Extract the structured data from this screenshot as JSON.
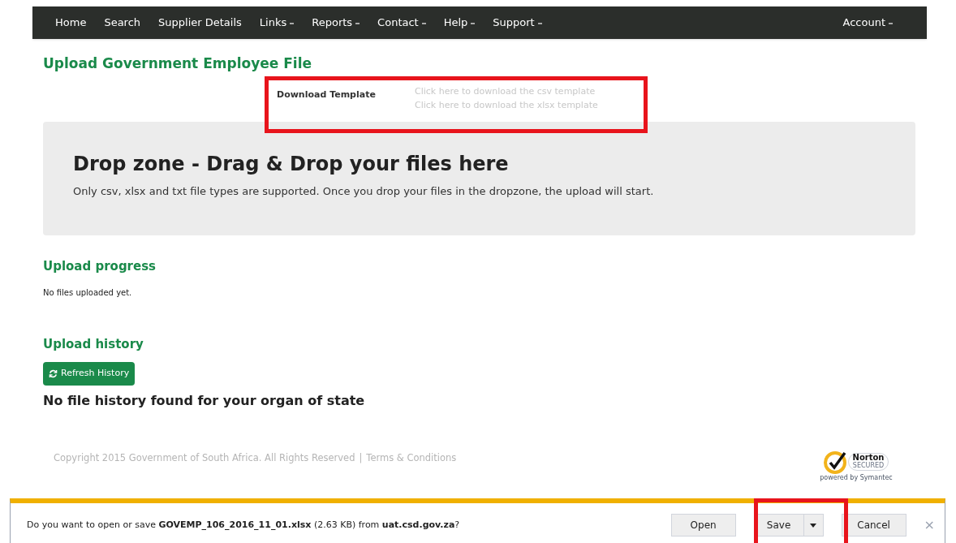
{
  "nav": {
    "items": [
      {
        "label": "Home",
        "dropdown": false
      },
      {
        "label": "Search",
        "dropdown": false
      },
      {
        "label": "Supplier Details",
        "dropdown": false
      },
      {
        "label": "Links",
        "dropdown": true
      },
      {
        "label": "Reports",
        "dropdown": true
      },
      {
        "label": "Contact",
        "dropdown": true
      },
      {
        "label": "Help",
        "dropdown": true
      },
      {
        "label": "Support",
        "dropdown": true
      }
    ],
    "account": {
      "label": "Account",
      "dropdown": true
    }
  },
  "page_title": "Upload Government Employee File",
  "download_template": {
    "label": "Download Template",
    "links": [
      "Click here to download the csv template",
      "Click here to download the xlsx template"
    ]
  },
  "drop_zone": {
    "heading": "Drop zone - Drag & Drop your files here",
    "hint": "Only csv, xlsx and txt file types are supported. Once you drop your files in the dropzone, the upload will start."
  },
  "upload_progress": {
    "heading": "Upload progress",
    "message": "No files uploaded yet."
  },
  "upload_history": {
    "heading": "Upload history",
    "button": "Refresh History",
    "message": "No file history found for your organ of state"
  },
  "footer": {
    "copyright": "Copyright 2015 Government of South Africa. All Rights Reserved",
    "separator": "|",
    "terms": "Terms & Conditions",
    "seal": {
      "name": "Norton",
      "sub": "SECURED",
      "by": "powered by Symantec"
    }
  },
  "download_bar": {
    "message": "Do you want to open or save **GOVEMP_106_2016_11_01.xlsx** (2.63 KB) from **uat.csd.gov.za**?",
    "buttons": [
      "Open",
      "Save",
      "Cancel"
    ],
    "close": "×"
  }
}
